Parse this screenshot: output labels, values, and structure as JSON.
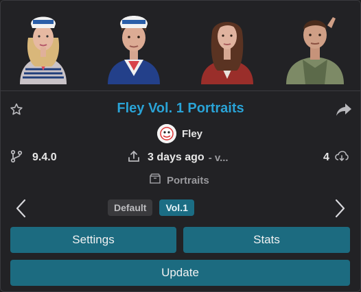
{
  "mod": {
    "title": "Fley Vol. 1 Portraits",
    "author": "Fley",
    "version": "9.4.0",
    "updated": "3 days ago",
    "updated_more": "- v...",
    "downloads": "4",
    "category": "Portraits"
  },
  "portraits": [
    {
      "label": "survivor-portrait-1"
    },
    {
      "label": "survivor-portrait-2"
    },
    {
      "label": "survivor-portrait-3"
    },
    {
      "label": "survivor-portrait-4"
    }
  ],
  "variants": {
    "default_label": "Default",
    "selected_label": "Vol.1"
  },
  "buttons": {
    "settings": "Settings",
    "stats": "Stats",
    "update": "Update"
  },
  "icons": {
    "favorite": "star-icon",
    "share": "share-arrow-icon",
    "version": "git-branch-icon",
    "updated": "upload-icon",
    "downloads": "cloud-download-icon",
    "category": "box-icon",
    "prev": "chevron-left-icon",
    "next": "chevron-right-icon"
  },
  "colors": {
    "accent": "#2aa3d6",
    "button": "#1c6b80",
    "selected_tag": "#1b6d84",
    "background": "#222225"
  }
}
